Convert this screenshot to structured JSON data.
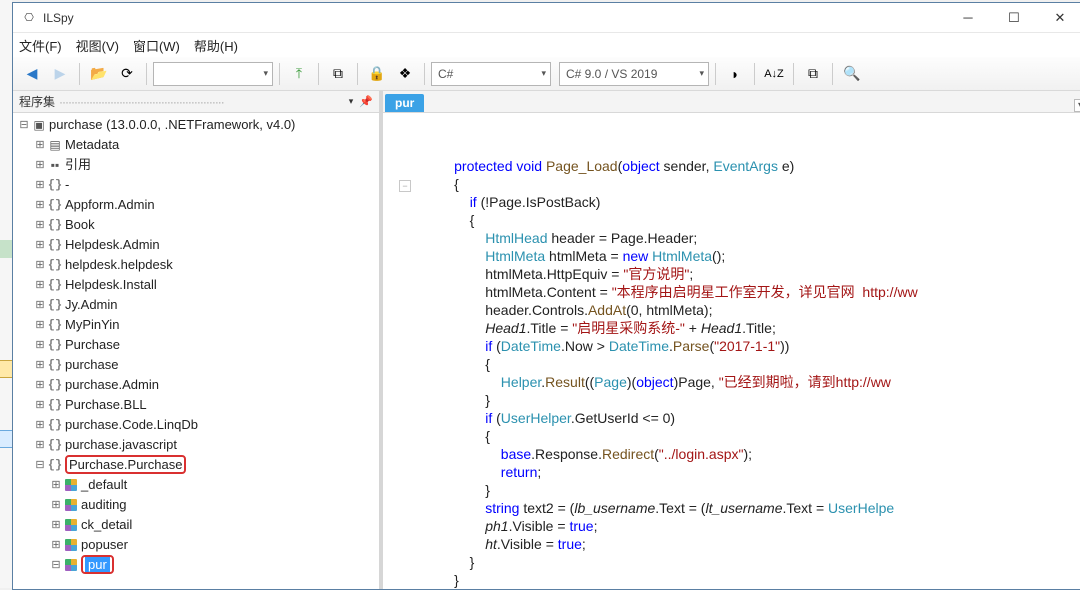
{
  "window": {
    "title": "ILSpy"
  },
  "menu": {
    "file": "文件(F)",
    "view": "视图(V)",
    "window": "窗口(W)",
    "help": "帮助(H)"
  },
  "toolbar": {
    "combo_empty_width": 120,
    "lang_combo": "C#",
    "ver_combo": "C# 9.0 / VS 2019"
  },
  "tree": {
    "header": "程序集",
    "root": "purchase (13.0.0.0, .NETFramework, v4.0)",
    "metadata": "Metadata",
    "refs": "引用",
    "ns": [
      "-",
      "Appform.Admin",
      "Book",
      "Helpdesk.Admin",
      "helpdesk.helpdesk",
      "Helpdesk.Install",
      "Jy.Admin",
      "MyPinYin",
      "Purchase",
      "purchase",
      "purchase.Admin",
      "Purchase.BLL",
      "purchase.Code.LinqDb",
      "purchase.javascript",
      "Purchase.Purchase"
    ],
    "ns_boxed_index": 14,
    "members": [
      "_default",
      "auditing",
      "ck_detail",
      "popuser",
      "pur"
    ],
    "member_sel_index": 4,
    "member_box_index": 4
  },
  "tab": {
    "active": "pur"
  },
  "code": {
    "tokens": [
      {
        "indent": 2,
        "parts": [
          {
            "t": "protected ",
            "c": "kw"
          },
          {
            "t": "void ",
            "c": "kw"
          },
          {
            "t": "Page_Load",
            "c": "method"
          },
          {
            "t": "("
          },
          {
            "t": "object ",
            "c": "kw"
          },
          {
            "t": "sender, "
          },
          {
            "t": "EventArgs",
            "c": "type"
          },
          {
            "t": " e)"
          }
        ]
      },
      {
        "indent": 2,
        "parts": [
          {
            "t": "{"
          }
        ]
      },
      {
        "indent": 3,
        "parts": [
          {
            "t": "if ",
            "c": "kw"
          },
          {
            "t": "(!Page.IsPostBack)"
          }
        ]
      },
      {
        "indent": 3,
        "parts": [
          {
            "t": "{"
          }
        ]
      },
      {
        "indent": 4,
        "parts": [
          {
            "t": "HtmlHead",
            "c": "type"
          },
          {
            "t": " header = Page.Header;"
          }
        ]
      },
      {
        "indent": 4,
        "parts": [
          {
            "t": "HtmlMeta",
            "c": "type"
          },
          {
            "t": " htmlMeta = "
          },
          {
            "t": "new ",
            "c": "kw"
          },
          {
            "t": "HtmlMeta",
            "c": "type"
          },
          {
            "t": "();"
          }
        ]
      },
      {
        "indent": 4,
        "parts": [
          {
            "t": "htmlMeta.HttpEquiv = "
          },
          {
            "t": "\"官方说明\"",
            "c": "str"
          },
          {
            "t": ";"
          }
        ]
      },
      {
        "indent": 4,
        "parts": [
          {
            "t": "htmlMeta.Content = "
          },
          {
            "t": "\"本程序由启明星工作室开发，详见官网  http://ww",
            "c": "str"
          }
        ]
      },
      {
        "indent": 4,
        "parts": [
          {
            "t": "header.Controls."
          },
          {
            "t": "AddAt",
            "c": "method"
          },
          {
            "t": "(0, htmlMeta);"
          }
        ]
      },
      {
        "indent": 4,
        "parts": [
          {
            "t": "Head1",
            "i": true
          },
          {
            "t": ".Title = "
          },
          {
            "t": "\"启明星采购系统-\"",
            "c": "str"
          },
          {
            "t": " + "
          },
          {
            "t": "Head1",
            "i": true
          },
          {
            "t": ".Title;"
          }
        ]
      },
      {
        "indent": 4,
        "parts": [
          {
            "t": "if ",
            "c": "kw"
          },
          {
            "t": "("
          },
          {
            "t": "DateTime",
            "c": "type"
          },
          {
            "t": ".Now > "
          },
          {
            "t": "DateTime",
            "c": "type"
          },
          {
            "t": "."
          },
          {
            "t": "Parse",
            "c": "method"
          },
          {
            "t": "("
          },
          {
            "t": "\"2017-1-1\"",
            "c": "str"
          },
          {
            "t": "))"
          }
        ]
      },
      {
        "indent": 4,
        "parts": [
          {
            "t": "{"
          }
        ]
      },
      {
        "indent": 5,
        "parts": [
          {
            "t": "Helper",
            "c": "type"
          },
          {
            "t": "."
          },
          {
            "t": "Result",
            "c": "method"
          },
          {
            "t": "(("
          },
          {
            "t": "Page",
            "c": "type"
          },
          {
            "t": ")("
          },
          {
            "t": "object",
            "c": "kw"
          },
          {
            "t": ")Page, "
          },
          {
            "t": "\"已经到期啦，请到http://ww",
            "c": "str"
          }
        ]
      },
      {
        "indent": 4,
        "parts": [
          {
            "t": "}"
          }
        ]
      },
      {
        "indent": 4,
        "parts": [
          {
            "t": "if ",
            "c": "kw"
          },
          {
            "t": "("
          },
          {
            "t": "UserHelper",
            "c": "type"
          },
          {
            "t": ".GetUserId <= 0)"
          }
        ]
      },
      {
        "indent": 4,
        "parts": [
          {
            "t": "{"
          }
        ]
      },
      {
        "indent": 5,
        "parts": [
          {
            "t": "base",
            "c": "kw"
          },
          {
            "t": ".Response."
          },
          {
            "t": "Redirect",
            "c": "method"
          },
          {
            "t": "("
          },
          {
            "t": "\"../login.aspx\"",
            "c": "str"
          },
          {
            "t": ");"
          }
        ]
      },
      {
        "indent": 5,
        "parts": [
          {
            "t": "return",
            "c": "kw"
          },
          {
            "t": ";"
          }
        ]
      },
      {
        "indent": 4,
        "parts": [
          {
            "t": "}"
          }
        ]
      },
      {
        "indent": 4,
        "parts": [
          {
            "t": "string ",
            "c": "kw"
          },
          {
            "t": "text2 = ("
          },
          {
            "t": "lb_username",
            "i": true
          },
          {
            "t": ".Text = ("
          },
          {
            "t": "lt_username",
            "i": true
          },
          {
            "t": ".Text = "
          },
          {
            "t": "UserHelpe",
            "c": "type"
          }
        ]
      },
      {
        "indent": 4,
        "parts": [
          {
            "t": "ph1",
            "i": true
          },
          {
            "t": ".Visible = "
          },
          {
            "t": "true",
            "c": "kw"
          },
          {
            "t": ";"
          }
        ]
      },
      {
        "indent": 4,
        "parts": [
          {
            "t": "ht",
            "i": true
          },
          {
            "t": ".Visible = "
          },
          {
            "t": "true",
            "c": "kw"
          },
          {
            "t": ";"
          }
        ]
      },
      {
        "indent": 3,
        "parts": [
          {
            "t": "}"
          }
        ]
      },
      {
        "indent": 2,
        "parts": [
          {
            "t": "}"
          }
        ]
      }
    ]
  }
}
